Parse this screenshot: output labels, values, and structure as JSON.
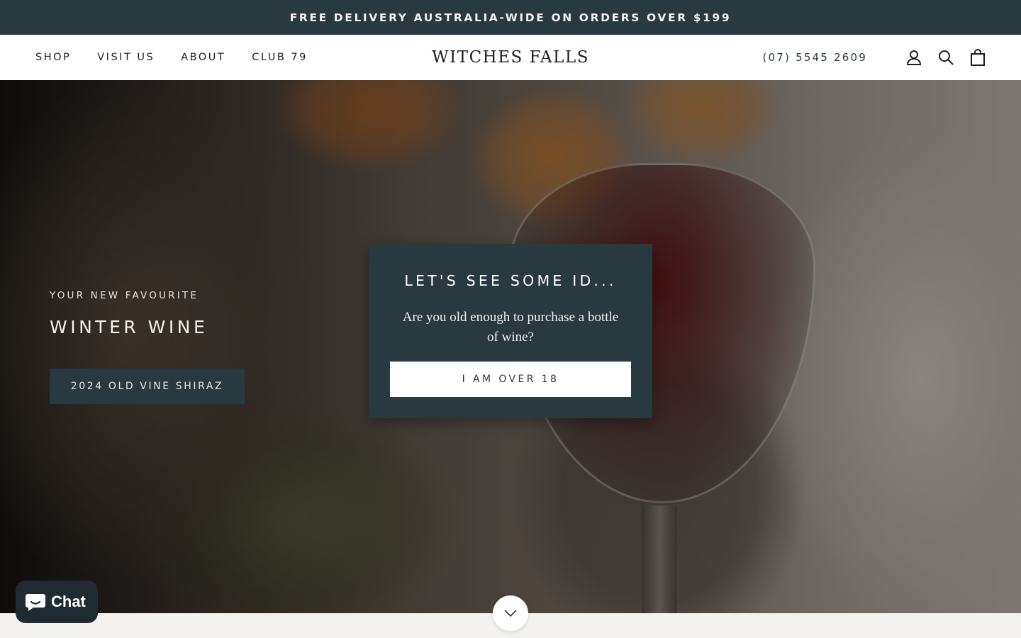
{
  "announcement": {
    "text": "FREE DELIVERY AUSTRALIA-WIDE ON ORDERS OVER $199"
  },
  "header": {
    "nav": [
      {
        "label": "SHOP"
      },
      {
        "label": "VISIT US"
      },
      {
        "label": "ABOUT"
      },
      {
        "label": "CLUB 79"
      }
    ],
    "logo": "WITCHES FALLS",
    "phone": "(07) 5545 2609",
    "icons": [
      "account-icon",
      "search-icon",
      "cart-icon"
    ]
  },
  "hero": {
    "eyebrow": "YOUR NEW FAVOURITE",
    "title": "WINTER WINE",
    "button_label": "2024 OLD VINE SHIRAZ"
  },
  "age_gate": {
    "title": "LET'S SEE SOME ID...",
    "text": "Are you old enough to purchase a bottle of wine?",
    "button_label": "I AM OVER 18"
  },
  "scroll_icon": "chevron-down-icon",
  "chat": {
    "label": "Chat",
    "icon": "chat-bubble-icon"
  },
  "colors": {
    "brand_dark": "#283940",
    "white": "#ffffff",
    "page_bg": "#f3f2ef",
    "chat_bg": "#1f2b30"
  }
}
